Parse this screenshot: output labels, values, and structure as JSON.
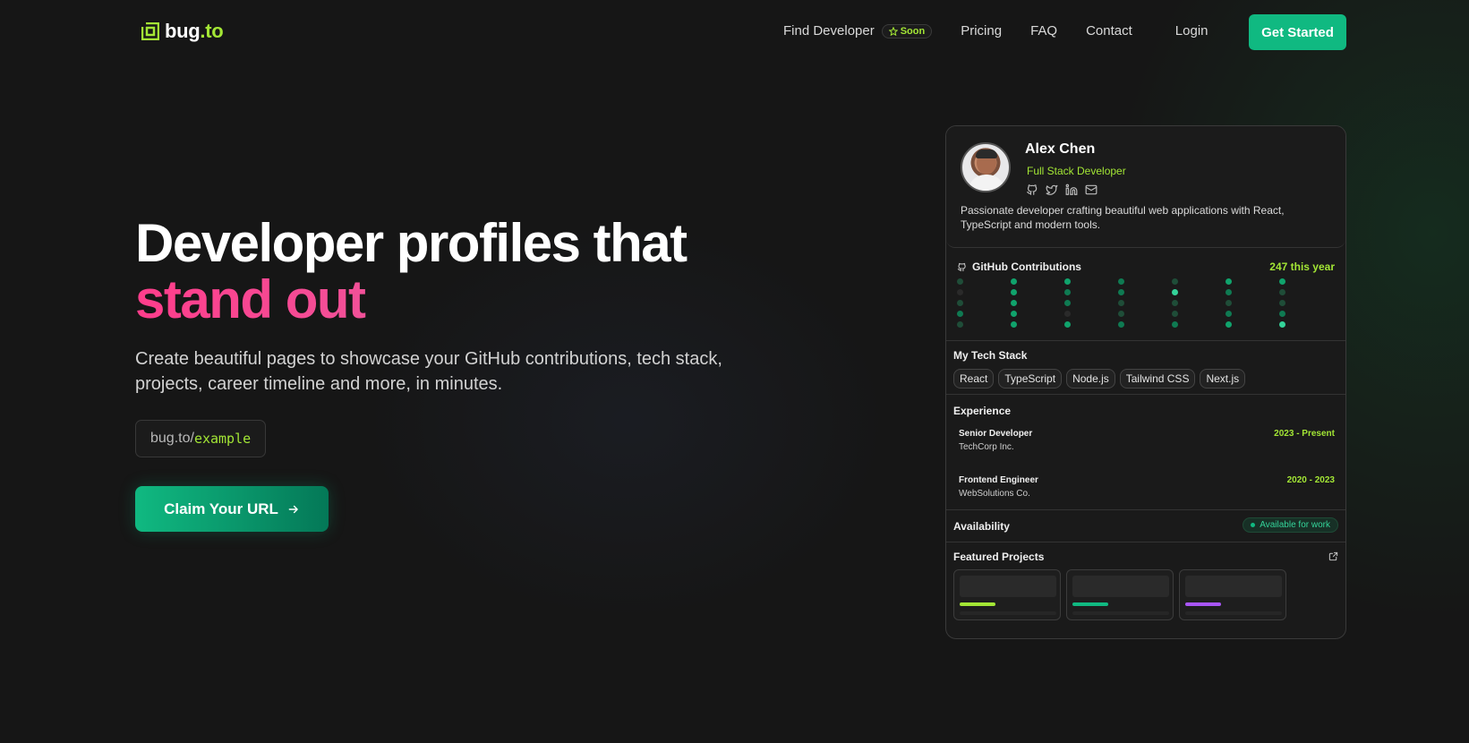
{
  "brand": {
    "name": "bug",
    "tld": ".to",
    "accent": "#a3e635",
    "icon": "logo-mark-icon"
  },
  "nav": {
    "links": [
      {
        "label": "Find Developer",
        "badge": "Soon"
      },
      {
        "label": "Pricing"
      },
      {
        "label": "FAQ"
      },
      {
        "label": "Contact"
      }
    ],
    "login": "Login",
    "cta": "Get Started",
    "cta_color": "#10b981"
  },
  "hero": {
    "title_line1": "Developer profiles that",
    "title_accent": "stand out",
    "subtitle": "Create beautiful pages to showcase your GitHub contributions, tech stack, projects, career timeline and more, in minutes.",
    "url_prefix": "bug.to/",
    "url_slug": "example",
    "claim_button": "Claim Your URL"
  },
  "profile": {
    "name": "Alex Chen",
    "role": "Full Stack Developer",
    "socials": [
      "github-icon",
      "twitter-icon",
      "linkedin-icon",
      "mail-icon"
    ],
    "bio": "Passionate developer crafting beautiful web applications with React, TypeScript and modern tools.",
    "contributions": {
      "title": "GitHub Contributions",
      "count": "247 this year"
    },
    "tech_stack": {
      "title": "My Tech Stack",
      "items": [
        "React",
        "TypeScript",
        "Node.js",
        "Tailwind CSS",
        "Next.js"
      ]
    },
    "experience": {
      "title": "Experience",
      "jobs": [
        {
          "title": "Senior Developer",
          "company": "TechCorp Inc.",
          "dates": "2023 - Present"
        },
        {
          "title": "Frontend Engineer",
          "company": "WebSolutions Co.",
          "dates": "2020 - 2023"
        }
      ]
    },
    "availability": {
      "title": "Availability",
      "status": "Available for work"
    },
    "projects": {
      "title": "Featured Projects",
      "accent_colors": [
        "#a3e635",
        "#10b981",
        "#a855f7"
      ]
    }
  }
}
